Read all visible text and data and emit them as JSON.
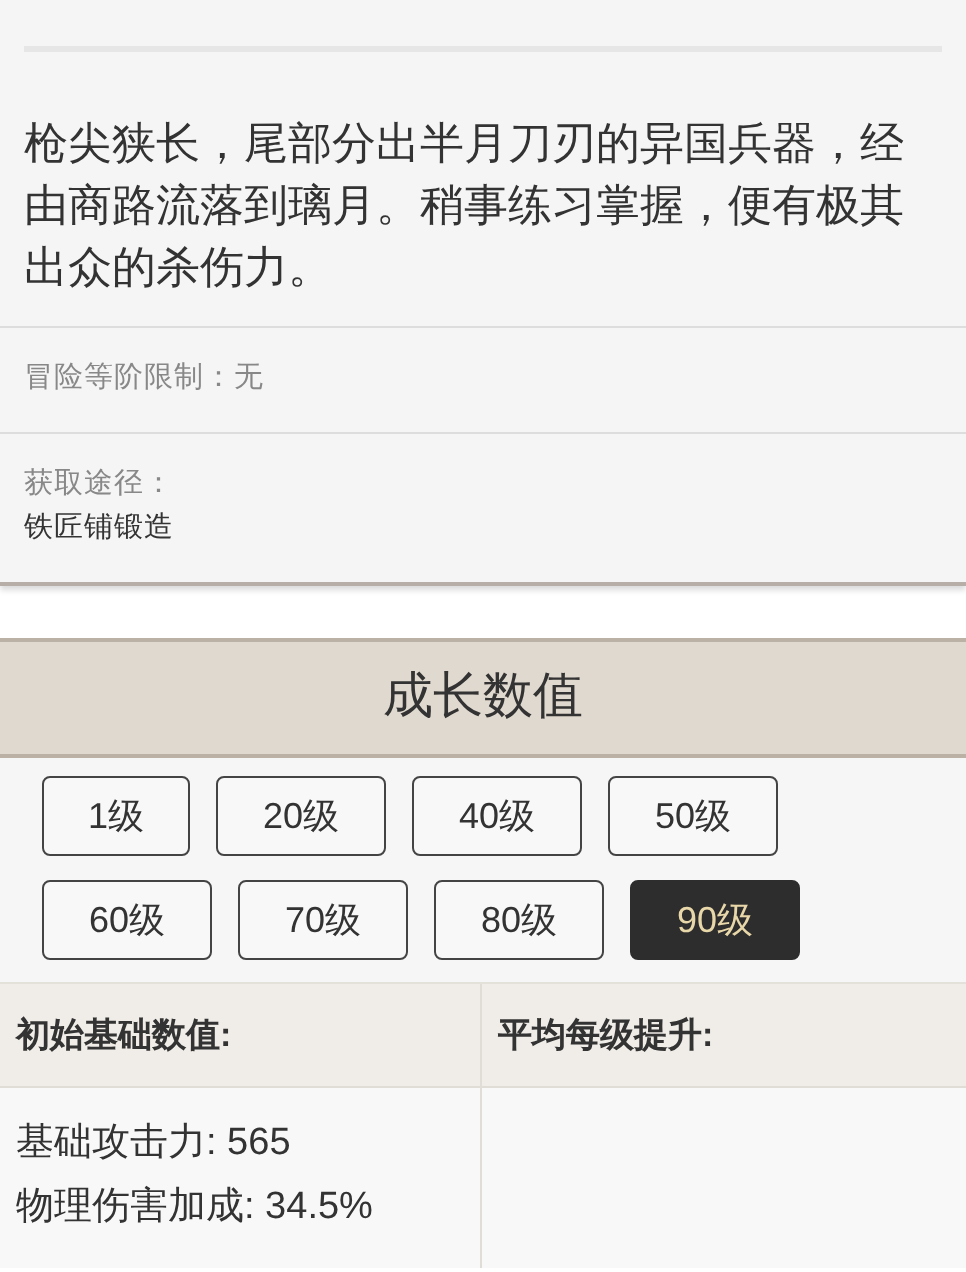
{
  "description": "枪尖狭长，尾部分出半月刀刃的异国兵器，经由商路流落到璃月。稍事练习掌握，便有极其出众的杀伤力。",
  "rank_limit": "冒险等阶限制：无",
  "source": {
    "label": "获取途径：",
    "value": "铁匠铺锻造"
  },
  "growth": {
    "title": "成长数值",
    "levels": [
      {
        "label": "1级",
        "selected": false
      },
      {
        "label": "20级",
        "selected": false
      },
      {
        "label": "40级",
        "selected": false
      },
      {
        "label": "50级",
        "selected": false
      },
      {
        "label": "60级",
        "selected": false
      },
      {
        "label": "70级",
        "selected": false
      },
      {
        "label": "80级",
        "selected": false
      },
      {
        "label": "90级",
        "selected": true
      }
    ],
    "table": {
      "columns": [
        "初始基础数值:",
        "平均每级提升:"
      ],
      "base_stats": [
        "基础攻击力: 565",
        "物理伤害加成: 34.5%"
      ]
    }
  }
}
